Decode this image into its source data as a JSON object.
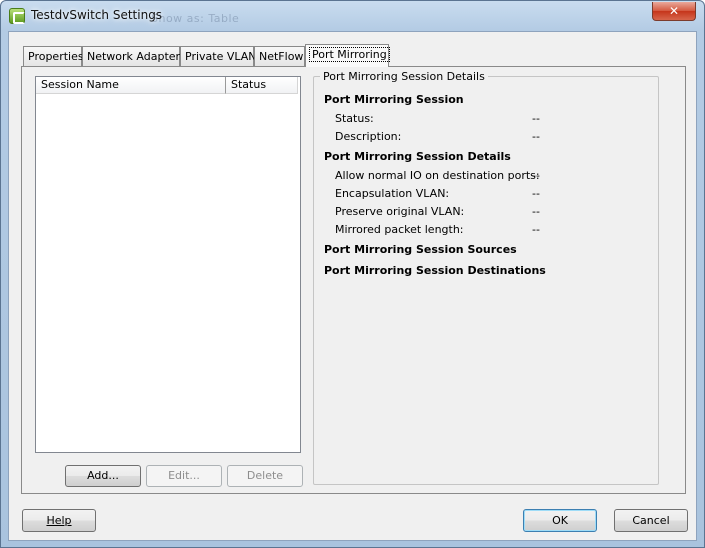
{
  "window": {
    "title": "TestdvSwitch Settings",
    "close_glyph": "✕",
    "background_ghost_text": "Show as: Table"
  },
  "tabs": [
    {
      "label": "Properties",
      "active": false
    },
    {
      "label": "Network Adapters",
      "active": false
    },
    {
      "label": "Private VLAN",
      "active": false
    },
    {
      "label": "NetFlow",
      "active": false
    },
    {
      "label": "Port Mirroring",
      "active": true
    }
  ],
  "sessions": {
    "columns": [
      "Session Name",
      "Status"
    ],
    "rows": [],
    "buttons": {
      "add": "Add...",
      "edit": "Edit...",
      "delete": "Delete"
    }
  },
  "details": {
    "group_title": "Port Mirroring Session Details",
    "session": {
      "title": "Port Mirroring Session",
      "status_label": "Status:",
      "status_value": "--",
      "description_label": "Description:",
      "description_value": "--"
    },
    "session_details": {
      "title": "Port Mirroring Session Details",
      "allow_io_label": "Allow normal IO on destination ports:",
      "allow_io_value": "--",
      "encap_vlan_label": "Encapsulation VLAN:",
      "encap_vlan_value": "--",
      "preserve_vlan_label": "Preserve original VLAN:",
      "preserve_vlan_value": "--",
      "packet_length_label": "Mirrored packet length:",
      "packet_length_value": "--"
    },
    "sources_title": "Port Mirroring Session Sources",
    "destinations_title": "Port Mirroring Session Destinations"
  },
  "footer": {
    "help": "Help",
    "ok": "OK",
    "cancel": "Cancel"
  }
}
